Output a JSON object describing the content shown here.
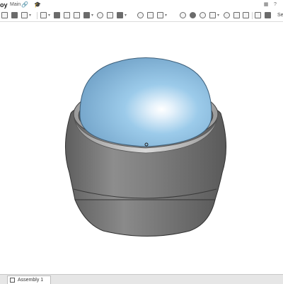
{
  "document": {
    "title": "oy",
    "branch": "Main",
    "link_icon": "link-icon",
    "branch_icon": "graduation-cap-icon"
  },
  "toolbar": {
    "search_label": "Se",
    "tools": [
      "undo-icon",
      "redo-icon",
      "sketch-icon",
      "insert-icon",
      "view-cube-icon",
      "section-icon",
      "display-icon",
      "measure-icon",
      "mate-icon",
      "fasten-mate-icon",
      "revolute-mate-icon",
      "slider-mate-icon",
      "group-icon",
      "replicate-icon",
      "pattern-icon",
      "explode-icon",
      "render-icon",
      "appearance-icon",
      "settings-icon"
    ]
  },
  "tabs": {
    "active_label": "Assembly 1"
  },
  "colors": {
    "dome": "#8ebfe2",
    "body": "#7d7d7d",
    "accent": "#1c6fb8"
  }
}
